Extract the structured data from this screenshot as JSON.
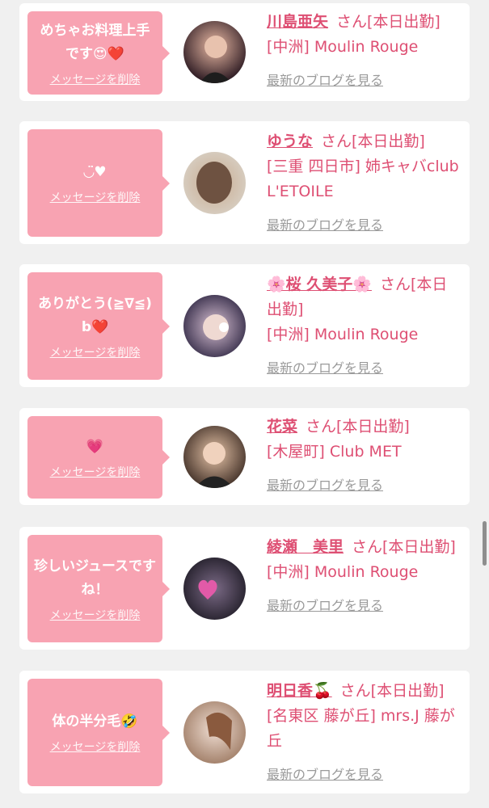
{
  "cards": [
    {
      "message": "めちゃお料理上手です😍❤️",
      "delete_label": "メッセージを削除",
      "name": "川島亜矢",
      "status": "さん[本日出勤]",
      "store": "[中洲] Moulin Rouge",
      "blog_label": "最新のブログを見る"
    },
    {
      "message": "◡̈♥︎",
      "delete_label": "メッセージを削除",
      "name": "ゆうな",
      "status": "さん[本日出勤]",
      "store": "[三重 四日市] 姉キャバclub L'ETOILE",
      "blog_label": "最新のブログを見る"
    },
    {
      "message": "ありがとう(≧∇≦)b❤️",
      "delete_label": "メッセージを削除",
      "name": "🌸桜 久美子🌸",
      "status": "さん[本日出勤]",
      "store": "[中洲] Moulin Rouge",
      "blog_label": "最新のブログを見る"
    },
    {
      "message": "💗",
      "delete_label": "メッセージを削除",
      "name": "花菜",
      "status": "さん[本日出勤]",
      "store": "[木屋町] Club MET",
      "blog_label": "最新のブログを見る"
    },
    {
      "message": "珍しいジュースですね！",
      "delete_label": "メッセージを削除",
      "name": "綾瀬　美里",
      "status": "さん[本日出勤]",
      "store": "[中洲] Moulin Rouge",
      "blog_label": "最新のブログを見る"
    },
    {
      "message": "体の半分毛🤣",
      "delete_label": "メッセージを削除",
      "name": "明日香🍒",
      "status": "さん[本日出勤]",
      "store": "[名東区 藤が丘] mrs.J 藤が丘",
      "blog_label": "最新のブログを見る"
    }
  ]
}
